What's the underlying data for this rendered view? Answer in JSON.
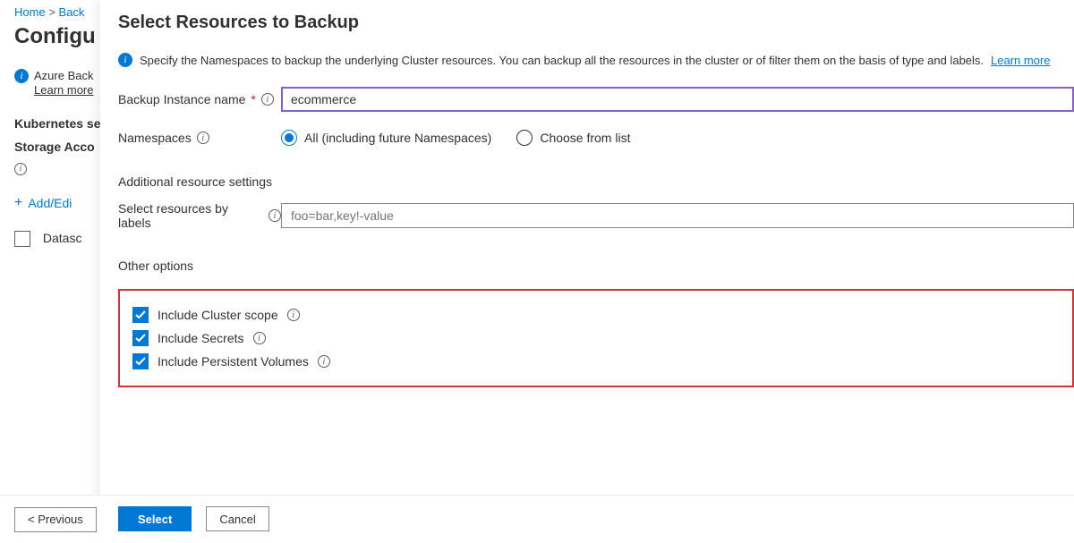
{
  "breadcrumb": {
    "home": "Home",
    "sep": ">",
    "back": "Back"
  },
  "bg": {
    "title": "Configu",
    "info_text": "Azure Back",
    "learn": "Learn more",
    "k8s_label": "Kubernetes se",
    "storage_label": "Storage Acco",
    "add_label": "Add/Edi",
    "datasource_label": "Datasc",
    "prev_btn": "< Previous"
  },
  "pane": {
    "title": "Select Resources to Backup",
    "note": "Specify the Namespaces to backup the underlying Cluster resources. You can backup all the resources in the cluster or of filter them on the basis of type and labels.",
    "learn_more": "Learn more",
    "instance_label": "Backup Instance name",
    "instance_value": "ecommerce",
    "ns_label": "Namespaces",
    "ns_all": "All (including future Namespaces)",
    "ns_choose": "Choose from list",
    "additional_heading": "Additional resource settings",
    "labels_label": "Select resources by labels",
    "labels_placeholder": "foo=bar,key!-value",
    "other_heading": "Other options",
    "chk_cluster": "Include Cluster scope",
    "chk_secrets": "Include Secrets",
    "chk_pv": "Include Persistent Volumes",
    "select_btn": "Select",
    "cancel_btn": "Cancel"
  }
}
